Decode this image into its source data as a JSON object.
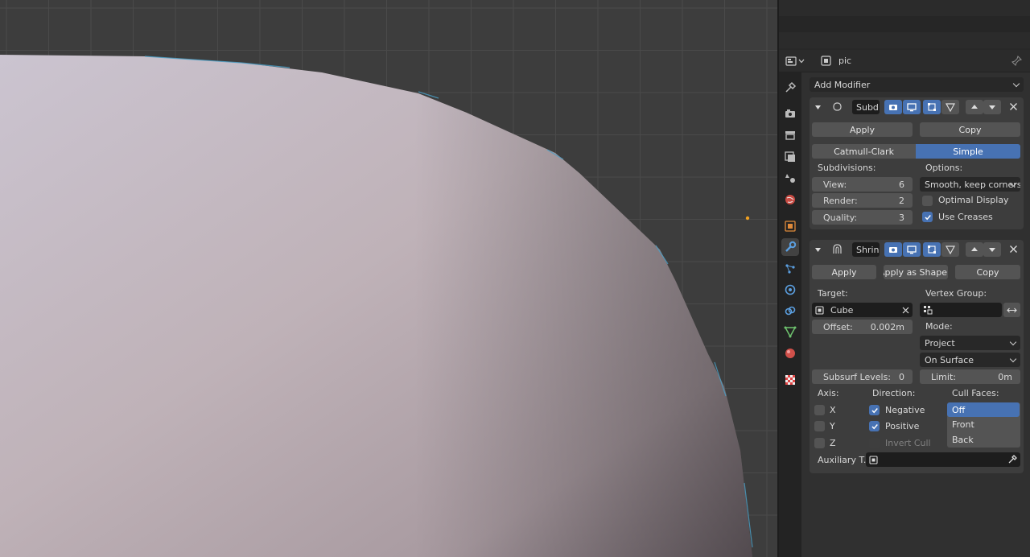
{
  "header": {
    "object_name": "pic",
    "add_modifier_label": "Add Modifier"
  },
  "tabs": [
    "tool-icon",
    "render-icon",
    "output-icon",
    "view-layer-icon",
    "scene-icon",
    "world-icon",
    "object-icon",
    "modifier-icon",
    "particles-icon",
    "physics-icon",
    "constraints-icon",
    "data-icon",
    "material-icon",
    "texture-icon"
  ],
  "subdivision": {
    "name": "Subd",
    "apply_label": "Apply",
    "copy_label": "Copy",
    "catmull_clark_label": "Catmull-Clark",
    "simple_label": "Simple",
    "subdivisions_label": "Subdivisions:",
    "options_label": "Options:",
    "view_label": "View:",
    "view_value": "6",
    "render_label": "Render:",
    "render_value": "2",
    "quality_label": "Quality:",
    "quality_value": "3",
    "uv_smooth_value": "Smooth, keep corners",
    "optimal_display_label": "Optimal Display",
    "use_creases_label": "Use Creases",
    "optimal_display_checked": false,
    "use_creases_checked": true
  },
  "shrinkwrap": {
    "name": "Shrin",
    "apply_label": "Apply",
    "apply_shape_label": "Apply as Shape..",
    "copy_label": "Copy",
    "target_label": "Target:",
    "target_value": "Cube",
    "vertex_group_label": "Vertex Group:",
    "offset_label": "Offset:",
    "offset_value": "0.002m",
    "mode_label": "Mode:",
    "wrap_method_value": "Project",
    "snap_mode_value": "On Surface",
    "subsurf_levels_label": "Subsurf Levels:",
    "subsurf_levels_value": "0",
    "limit_label": "Limit:",
    "limit_value": "0m",
    "axis_label": "Axis:",
    "axis_x": "X",
    "axis_y": "Y",
    "axis_z": "Z",
    "direction_label": "Direction:",
    "negative_label": "Negative",
    "positive_label": "Positive",
    "invert_cull_label": "Invert Cull",
    "cull_faces_label": "Cull Faces:",
    "cull_options": [
      "Off",
      "Front",
      "Back"
    ],
    "cull_selected": "Off",
    "auxiliary_label": "Auxiliary T.."
  },
  "colors": {
    "accent": "#4772b3",
    "panel_bg": "#3d3d3d",
    "viewport_bg": "#3d3d3d",
    "mesh_light": "#cdc6d2",
    "mesh_dark": "#8a7f86"
  }
}
